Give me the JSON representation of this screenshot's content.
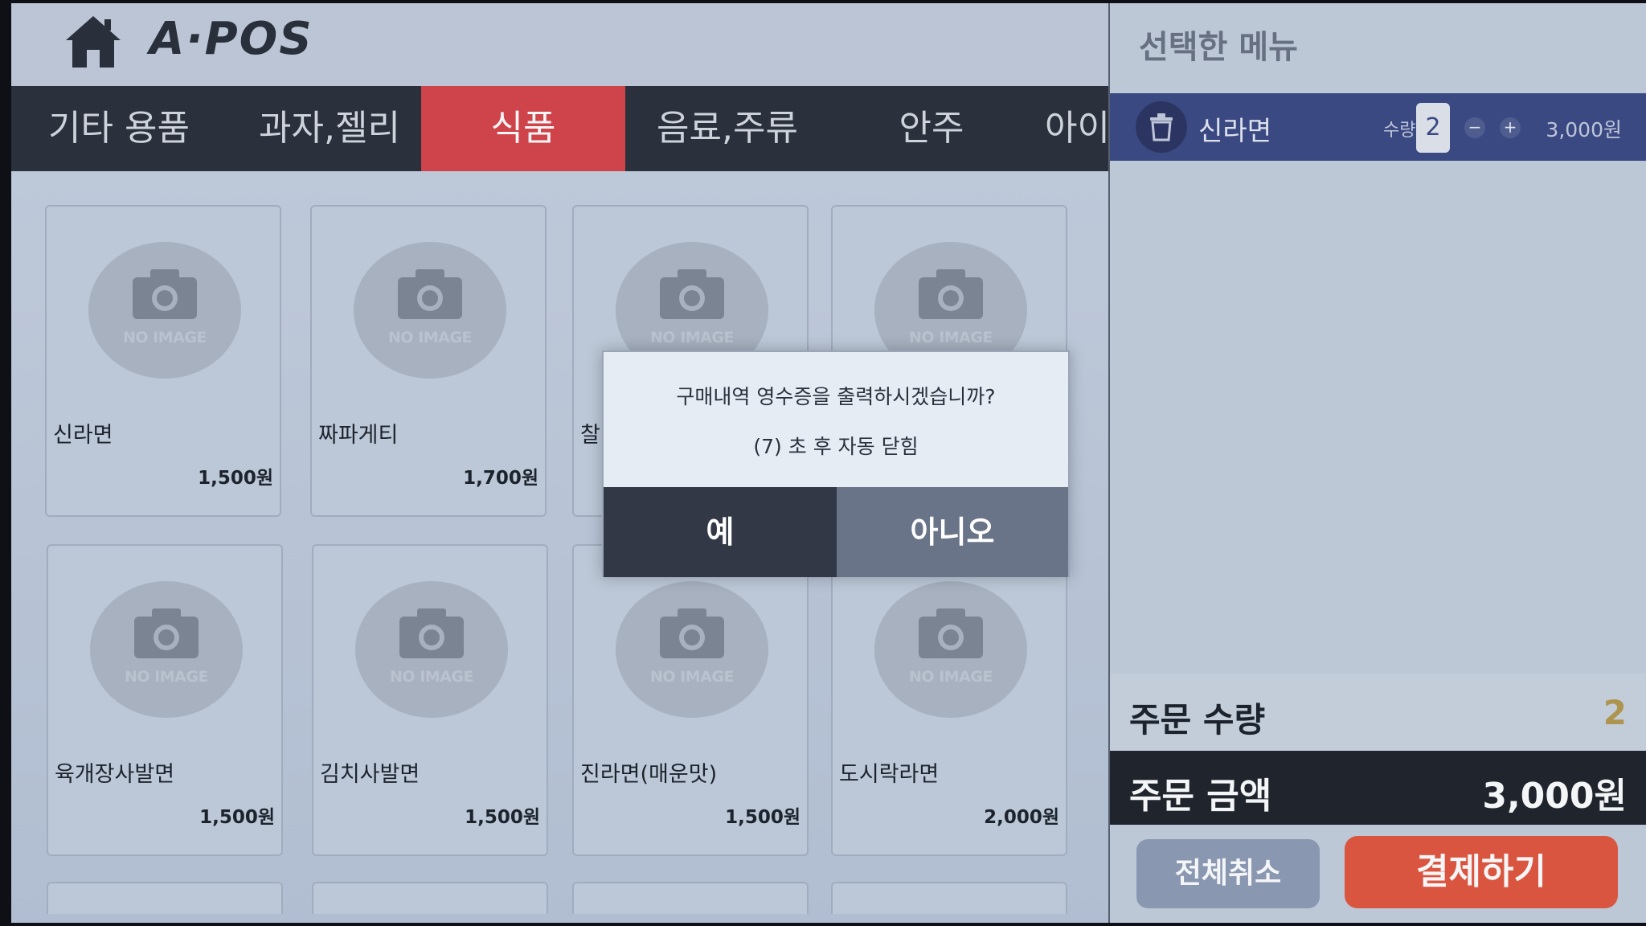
{
  "header": {
    "logo": "A·POS"
  },
  "tabs": [
    {
      "label": "기타 용품",
      "active": false
    },
    {
      "label": "과자,젤리",
      "active": false
    },
    {
      "label": "식품",
      "active": true
    },
    {
      "label": "음료,주류",
      "active": false
    },
    {
      "label": "안주",
      "active": false
    },
    {
      "label": "아이",
      "active": false
    }
  ],
  "products": [
    {
      "name": "신라면",
      "price": "1,500원",
      "image_text": "NO IMAGE"
    },
    {
      "name": "짜파게티",
      "price": "1,700원",
      "image_text": "NO IMAGE"
    },
    {
      "name": "찰",
      "price": "",
      "image_text": "NO IMAGE"
    },
    {
      "name": "",
      "price": "",
      "image_text": "NO IMAGE"
    },
    {
      "name": "육개장사발면",
      "price": "1,500원",
      "image_text": "NO IMAGE"
    },
    {
      "name": "김치사발면",
      "price": "1,500원",
      "image_text": "NO IMAGE"
    },
    {
      "name": "진라면(매운맛)",
      "price": "1,500원",
      "image_text": "NO IMAGE"
    },
    {
      "name": "도시락라면",
      "price": "2,000원",
      "image_text": "NO IMAGE"
    }
  ],
  "cart": {
    "title": "선택한 메뉴",
    "items": [
      {
        "name": "신라면",
        "qty_label": "수량",
        "qty": "2",
        "minus": "−",
        "plus": "+",
        "amount": "3,000원"
      }
    ],
    "order_qty_label": "주문 수량",
    "order_qty": "2",
    "order_amount_label": "주문 금액",
    "order_amount": "3,000원",
    "cancel_all_label": "전체취소",
    "pay_label": "결제하기"
  },
  "dialog": {
    "message": "구매내역 영수증을 출력하시겠습니까?",
    "countdown": "(7) 초 후 자동 닫힘",
    "yes_label": "예",
    "no_label": "아니오"
  },
  "colors": {
    "tab_bar": "#2c313c",
    "active_tab": "#d9444a",
    "cart_row": "#3d4a86",
    "pay_button": "#e3573f",
    "cancel_button": "#8f9cb7"
  }
}
